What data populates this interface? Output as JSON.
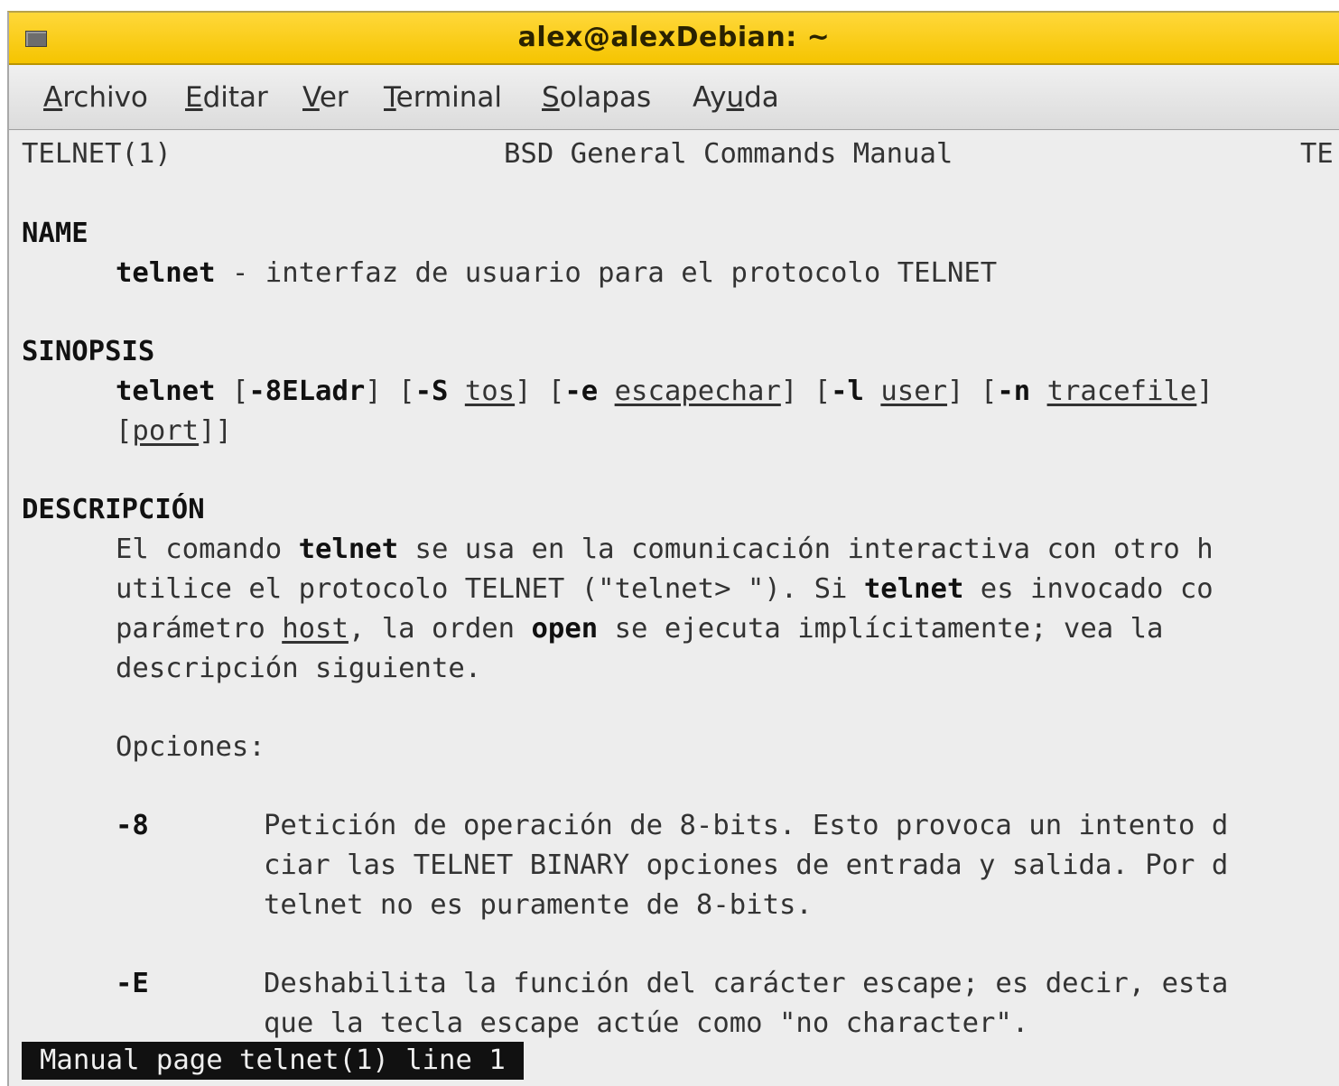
{
  "window": {
    "title": "alex@alexDebian: ~"
  },
  "menu": [
    {
      "pre": "",
      "acc": "A",
      "post": "rchivo"
    },
    {
      "pre": "",
      "acc": "E",
      "post": "ditar"
    },
    {
      "pre": "",
      "acc": "V",
      "post": "er"
    },
    {
      "pre": "",
      "acc": "T",
      "post": "erminal"
    },
    {
      "pre": "",
      "acc": "S",
      "post": "olapas"
    },
    {
      "pre": "Ay",
      "acc": "u",
      "post": "da"
    }
  ],
  "man": {
    "header_left": "TELNET(1)",
    "header_center": "BSD General Commands Manual",
    "header_right": "TE",
    "name_heading": "NAME",
    "name_cmd": "telnet",
    "name_desc": " - interfaz de usuario para el protocolo TELNET",
    "sinopsis_heading": "SINOPSIS",
    "syn": {
      "cmd": "telnet",
      "t1": " [",
      "opt1": "-8ELadr",
      "t2": "] [",
      "opt2": "-S",
      "t3": " ",
      "arg2": "tos",
      "t4": "] [",
      "opt3": "-e",
      "t5": " ",
      "arg3": "escapechar",
      "t6": "] [",
      "opt4": "-l",
      "t7": " ",
      "arg4": "user",
      "t8": "] [",
      "opt5": "-n",
      "t9": " ",
      "arg5": "tracefile",
      "t10": "]",
      "l2a": "[",
      "l2arg": "port",
      "l2b": "]]"
    },
    "desc_heading": "DESCRIPCIÓN",
    "desc": {
      "l1a": "El comando ",
      "l1b": "telnet",
      "l1c": " se usa en la comunicación interactiva con otro h",
      "l2a": "utilice el protocolo TELNET (\"telnet> \"). Si ",
      "l2b": "telnet",
      "l2c": " es invocado co",
      "l3a": "parámetro ",
      "l3b": "host",
      "l3c": ", la orden ",
      "l3d": "open",
      "l3e": " se ejecuta implícitamente; vea la",
      "l4": "descripción siguiente."
    },
    "opciones": "Opciones:",
    "opt8": {
      "flag": "-8",
      "l1": "Petición de operación de 8-bits. Esto provoca un intento d",
      "l2": "ciar las TELNET BINARY opciones de entrada y salida. Por d",
      "l3": "telnet no es puramente de 8-bits."
    },
    "optE": {
      "flag": "-E",
      "l1": "Deshabilita la función del carácter escape; es decir, esta",
      "l2": "que la tecla escape actúe como \"no character\"."
    }
  },
  "status": "Manual page telnet(1) line 1"
}
